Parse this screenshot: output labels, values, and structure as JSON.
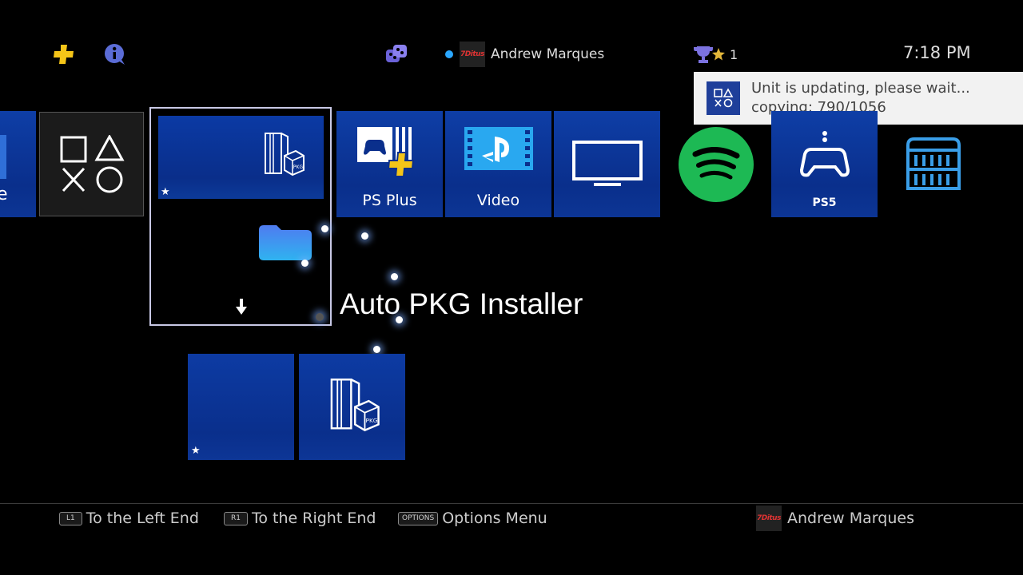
{
  "header": {
    "user_name": "Andrew Marques",
    "avatar_text": "7Ditus",
    "trophy_count": "1",
    "time": "7:18 PM"
  },
  "notification": {
    "line1": "Unit is updating, please wait...",
    "line2": "copying: 790/1056"
  },
  "tiles": {
    "partial_label": "e",
    "ps_plus_label": "PS Plus",
    "video_label": "Video",
    "ps5_label": "PS5"
  },
  "folder": {
    "title": "Auto PKG Installer",
    "pkg_badge": "PKG"
  },
  "bottom_bar": {
    "hints": [
      {
        "key": "L1",
        "label": "To the Left End"
      },
      {
        "key": "R1",
        "label": "To the Right End"
      },
      {
        "key": "OPTIONS",
        "label": "Options Menu"
      }
    ],
    "user_name": "Andrew Marques"
  },
  "colors": {
    "tile_blue": "#0a2f8c",
    "spotify_green": "#1db954",
    "plus_yellow": "#f5c518",
    "online_blue": "#2aa7ff"
  },
  "icons": [
    "plus-icon",
    "info-icon",
    "friends-icon",
    "trophy-icon",
    "ps-symbols-icon",
    "ps4-pkg-icon",
    "ps-plus-icon",
    "video-icon",
    "tv-icon",
    "spotify-icon",
    "ps5-controller-icon",
    "library-icon",
    "folder-icon",
    "download-arrow-icon"
  ]
}
